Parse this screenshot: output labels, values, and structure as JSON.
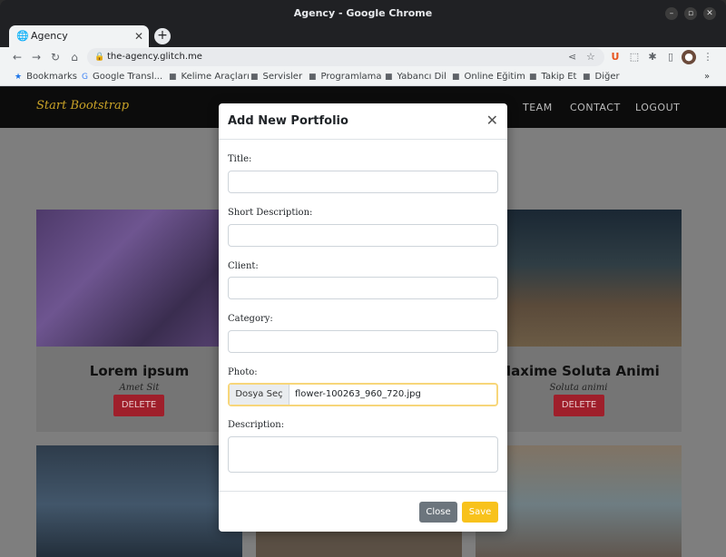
{
  "window": {
    "title": "Agency - Google Chrome"
  },
  "tab": {
    "title": "Agency",
    "icon": "globe-icon"
  },
  "address": {
    "url": "the-agency.glitch.me"
  },
  "bookmarks": [
    "Bookmarks",
    "Google Transl...",
    "Kelime Araçları",
    "Servisler",
    "Programlama",
    "Yabancı Dil",
    "Online Eğitim",
    "Takip Et",
    "Diğer"
  ],
  "site": {
    "brand": "Start Bootstrap",
    "nav": [
      "TEAM",
      "CONTACT",
      "LOGOUT"
    ]
  },
  "cards": [
    {
      "title": "Lorem ipsum",
      "subtitle": "Amet Sit",
      "delete": "DELETE"
    },
    {
      "title": "Maxime Soluta Animi",
      "subtitle": "Soluta animi",
      "delete": "DELETE"
    }
  ],
  "modal": {
    "title": "Add New Portfolio",
    "fields": {
      "title": "Title:",
      "short": "Short Description:",
      "client": "Client:",
      "category": "Category:",
      "photo": "Photo:",
      "description": "Description:"
    },
    "file_button": "Dosya Seç",
    "file_name": "flower-100263_960_720.jpg",
    "close": "Close",
    "save": "Save"
  },
  "colors": {
    "brand": "#c9a227",
    "danger": "#9f1f2b",
    "save": "#f8c21c",
    "close": "#6c757d"
  }
}
